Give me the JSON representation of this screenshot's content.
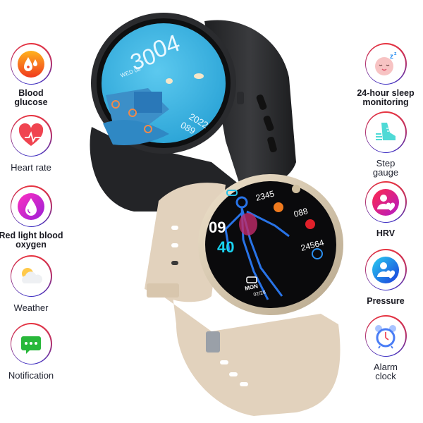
{
  "features_left": [
    {
      "id": "blood-glucose",
      "label_lines": [
        "Blood",
        "glucose"
      ],
      "icon": "blood-drop-icon"
    },
    {
      "id": "heart-rate",
      "label_lines": [
        "Heart rate"
      ],
      "icon": "heart-pulse-icon"
    },
    {
      "id": "blood-oxygen",
      "label_lines": [
        "Red light blood",
        "oxygen"
      ],
      "icon": "oxygen-drop-icon"
    },
    {
      "id": "weather",
      "label_lines": [
        "Weather"
      ],
      "icon": "weather-cloud-icon"
    },
    {
      "id": "notification",
      "label_lines": [
        "Notification"
      ],
      "icon": "chat-bubble-icon"
    }
  ],
  "features_right": [
    {
      "id": "sleep",
      "label_lines": [
        "24-hour sleep",
        "monitoring"
      ],
      "icon": "sleep-face-icon"
    },
    {
      "id": "step",
      "label_lines": [
        "Step",
        "gauge"
      ],
      "icon": "shoe-icon"
    },
    {
      "id": "hrv",
      "label_lines": [
        "HRV"
      ],
      "icon": "person-heart-icon"
    },
    {
      "id": "pressure",
      "label_lines": [
        "Pressure"
      ],
      "icon": "person-heart-blue-icon"
    },
    {
      "id": "alarm",
      "label_lines": [
        "Alarm",
        "clock"
      ],
      "icon": "alarm-clock-icon"
    }
  ],
  "watch_black": {
    "hour": "04",
    "minute": "30",
    "date": "WED 08",
    "year": "2022",
    "heart": "089"
  },
  "watch_gold": {
    "hour": "09",
    "minute": "40",
    "calories": "2345",
    "heart": "088",
    "steps": "24564",
    "weekday": "MON",
    "date": "02/28"
  },
  "colors": {
    "ring_top": "#e8343f",
    "ring_bottom": "#3b2fc4",
    "black_face": "#3fb6e0",
    "gold_band": "#e2d2bd",
    "minute_cyan": "#19d3f0"
  }
}
